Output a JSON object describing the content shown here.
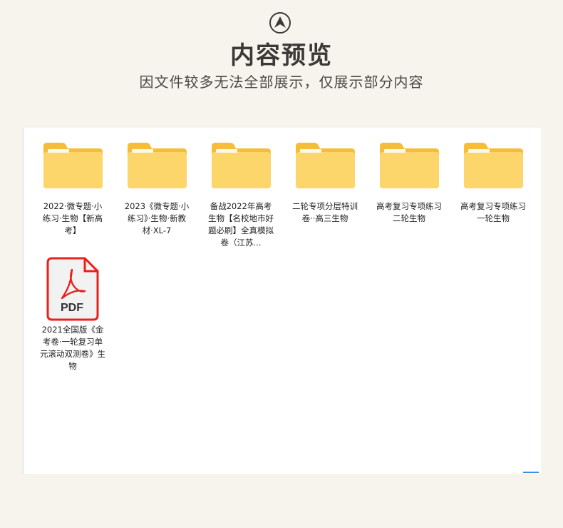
{
  "header": {
    "icon": "navigation-arrow-icon",
    "title": "内容预览",
    "subtitle": "因文件较多无法全部展示，仅展示部分内容"
  },
  "files": [
    {
      "type": "folder",
      "icon": "folder-icon",
      "name": "2022·微专题·小练习·生物【新高考】"
    },
    {
      "type": "folder",
      "icon": "folder-icon",
      "name": "2023《微专题·小练习》·生物·新教材·XL-7"
    },
    {
      "type": "folder",
      "icon": "folder-icon",
      "name": "备战2022年高考生物【名校地市好题必刷】全真模拟卷（江苏..."
    },
    {
      "type": "folder",
      "icon": "folder-icon",
      "name": "二轮专项分层特训卷··高三生物"
    },
    {
      "type": "folder",
      "icon": "folder-icon",
      "name": "高考复习专项练习二轮生物"
    },
    {
      "type": "folder",
      "icon": "folder-icon",
      "name": "高考复习专项练习一轮生物"
    },
    {
      "type": "pdf",
      "icon": "pdf-file-icon",
      "badge": "PDF",
      "name": "2021全国版《金考卷·一轮复习单元滚动双测卷》生物"
    }
  ],
  "colors": {
    "background": "#f7f4ee",
    "folder": "#fcd56b",
    "folder_tab": "#f5bd3a",
    "pdf_border": "#e8221b"
  }
}
